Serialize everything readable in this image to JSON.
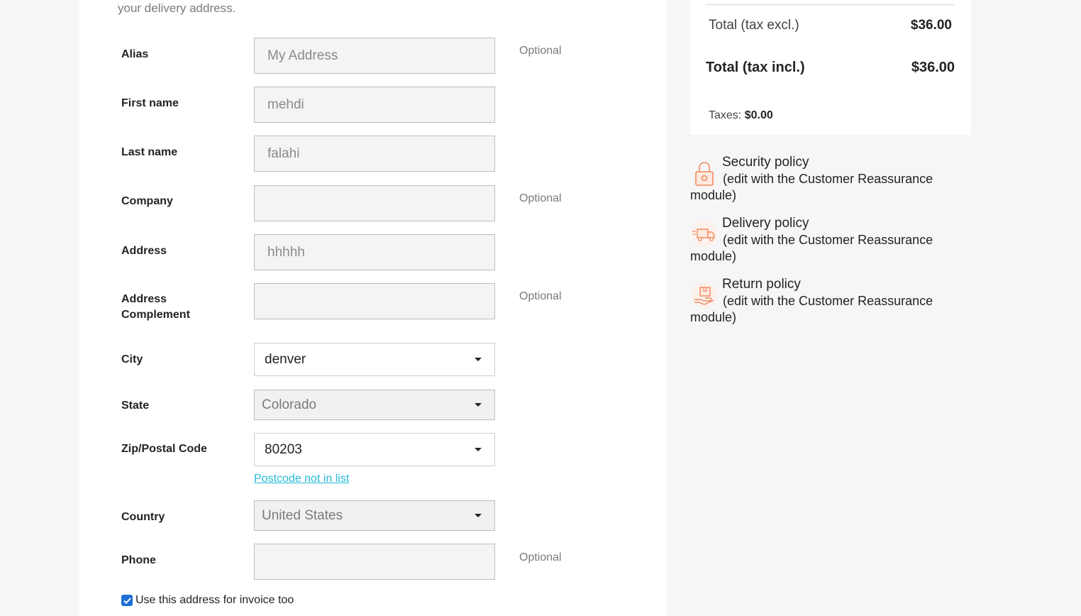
{
  "intro_text": "your delivery address.",
  "form": {
    "alias": {
      "label": "Alias",
      "value": "My Address",
      "note": "Optional"
    },
    "firstname": {
      "label": "First name",
      "value": "mehdi"
    },
    "lastname": {
      "label": "Last name",
      "value": "falahi"
    },
    "company": {
      "label": "Company",
      "value": "",
      "note": "Optional"
    },
    "address": {
      "label": "Address",
      "value": "hhhhh"
    },
    "address2": {
      "label": "Address Complement",
      "value": "",
      "note": "Optional"
    },
    "city": {
      "label": "City",
      "value": "denver"
    },
    "state": {
      "label": "State",
      "value": "Colorado"
    },
    "zip": {
      "label": "Zip/Postal Code",
      "value": "80203",
      "link": "Postcode not in list"
    },
    "country": {
      "label": "Country",
      "value": "United States"
    },
    "phone": {
      "label": "Phone",
      "value": "",
      "note": "Optional"
    },
    "invoice_checkbox": {
      "label": "Use this address for invoice too",
      "checked": true
    }
  },
  "summary": {
    "total_excl_label": "Total (tax excl.)",
    "total_excl_value": "$36.00",
    "total_incl_label": "Total (tax incl.)",
    "total_incl_value": "$36.00",
    "taxes_label": "Taxes:",
    "taxes_value": "$0.00"
  },
  "reassurance": [
    {
      "title": "Security policy",
      "desc": "(edit with the Customer Reassurance module)",
      "icon": "lock-icon"
    },
    {
      "title": "Delivery policy",
      "desc": "(edit with the Customer Reassurance module)",
      "icon": "truck-icon"
    },
    {
      "title": "Return policy",
      "desc": "(edit with the Customer Reassurance module)",
      "icon": "return-box-icon"
    }
  ],
  "colors": {
    "accent_link": "#24b9d7",
    "icon_orange": "#f08a5d",
    "checkbox": "#1f6fd6"
  }
}
